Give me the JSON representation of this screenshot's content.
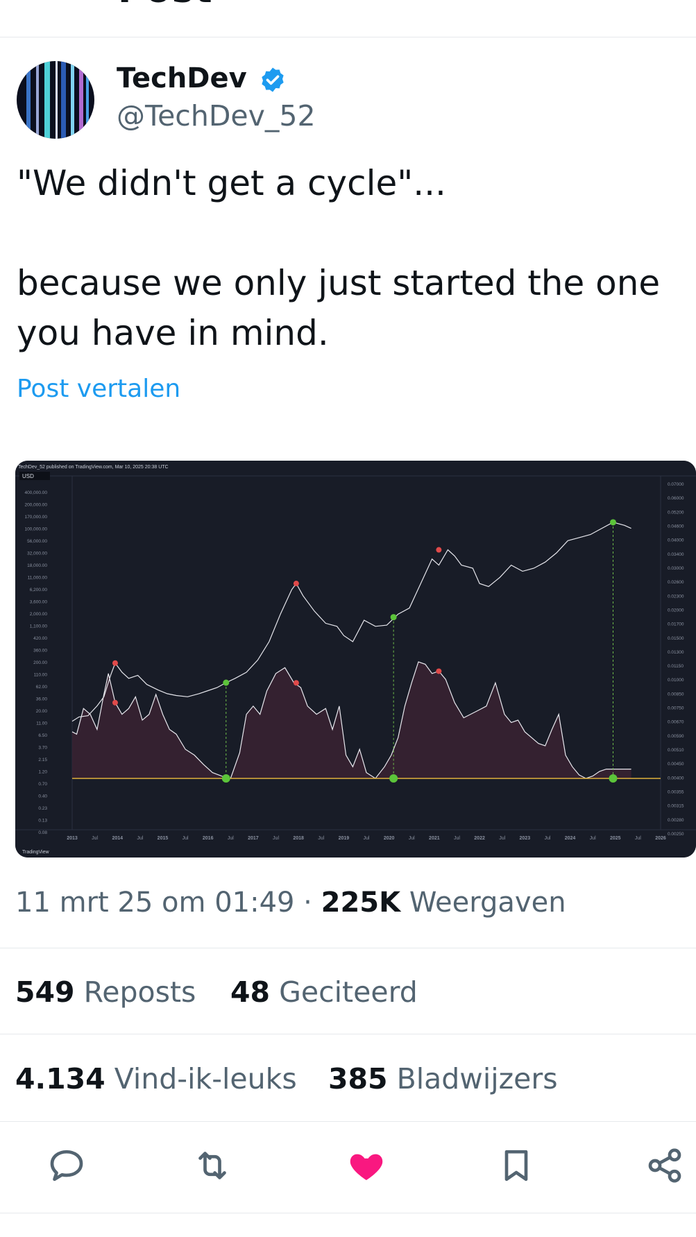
{
  "header": {
    "title_fragment": "Post"
  },
  "author": {
    "name": "TechDev",
    "handle": "@TechDev_52",
    "verified": true
  },
  "tweet": {
    "text": "\"We didn't get a cycle\"...\n\nbecause we only just started the one\nyou have in mind.",
    "translate_label": "Post vertalen"
  },
  "meta": {
    "time": "11 mrt 25 om 01:49",
    "separator": " · ",
    "views_count": "225K",
    "views_label": "Weergaven"
  },
  "stats": {
    "reposts_count": "549",
    "reposts_label": "Reposts",
    "quotes_count": "48",
    "quotes_label": "Geciteerd",
    "likes_count": "4.134",
    "likes_label": "Vind-ik-leuks",
    "bookmarks_count": "385",
    "bookmarks_label": "Bladwijzers"
  },
  "colors": {
    "like_active": "#f91880",
    "link": "#1d9bf0",
    "chart_bg": "#181c27",
    "baseline": "#e0b23c"
  },
  "actions": [
    "reply-icon",
    "repost-icon",
    "like-icon",
    "bookmark-icon",
    "share-icon"
  ],
  "chart_data": {
    "type": "line",
    "header_text": "TechDev_52 published on TradingView.com, Mar 10, 2025 20:38 UTC",
    "currency_label": "USD",
    "watermark": "TradingView",
    "left_axis_ticks": [
      "400,000.00",
      "200,000.00",
      "170,000.00",
      "100,000.00",
      "56,000.00",
      "32,000.00",
      "18,000.00",
      "11,000.00",
      "6,200.00",
      "3,600.00",
      "2,000.00",
      "1,100.00",
      "420.00",
      "360.00",
      "200.00",
      "110.00",
      "62.00",
      "36.00",
      "20.00",
      "11.00",
      "6.50",
      "3.70",
      "2.15",
      "1.20",
      "0.70",
      "0.40",
      "0.23",
      "0.13",
      "0.08"
    ],
    "right_axis_ticks": [
      "0.07000",
      "0.06000",
      "0.05200",
      "0.04600",
      "0.04000",
      "0.03400",
      "0.03000",
      "0.02600",
      "0.02300",
      "0.02000",
      "0.01700",
      "0.01500",
      "0.01300",
      "0.01150",
      "0.01000",
      "0.00850",
      "0.00750",
      "0.00670",
      "0.00590",
      "0.00510",
      "0.00450",
      "0.00400",
      "0.00355",
      "0.00315",
      "0.00280",
      "0.00250"
    ],
    "x_ticks": [
      "2013",
      "Jul",
      "2014",
      "Jul",
      "2015",
      "Jul",
      "2016",
      "Jul",
      "2017",
      "Jul",
      "2018",
      "Jul",
      "2019",
      "Jul",
      "2020",
      "Jul",
      "2021",
      "Jul",
      "2022",
      "Jul",
      "2023",
      "Jul",
      "2024",
      "Jul",
      "2025",
      "Jul",
      "2026"
    ],
    "x_range": [
      2013.0,
      2026.0
    ],
    "price_series": {
      "x": [
        2013.0,
        2013.15,
        2013.35,
        2013.55,
        2013.7,
        2013.85,
        2013.95,
        2014.1,
        2014.25,
        2014.45,
        2014.65,
        2014.9,
        2015.1,
        2015.3,
        2015.55,
        2015.8,
        2016.0,
        2016.2,
        2016.4,
        2016.6,
        2016.85,
        2017.1,
        2017.35,
        2017.6,
        2017.85,
        2017.95,
        2018.1,
        2018.35,
        2018.6,
        2018.85,
        2019.0,
        2019.2,
        2019.45,
        2019.7,
        2019.95,
        2020.2,
        2020.45,
        2020.7,
        2020.95,
        2021.1,
        2021.3,
        2021.45,
        2021.6,
        2021.85,
        2022.0,
        2022.2,
        2022.45,
        2022.7,
        2022.95,
        2023.2,
        2023.45,
        2023.7,
        2023.95,
        2024.2,
        2024.45,
        2024.7,
        2024.95,
        2025.2,
        2025.35
      ],
      "y": [
        0.05,
        0.12,
        0.14,
        0.3,
        0.45,
        0.8,
        1.0,
        0.85,
        0.75,
        0.8,
        0.65,
        0.56,
        0.5,
        0.47,
        0.45,
        0.5,
        0.55,
        0.6,
        0.68,
        0.75,
        0.85,
        1.05,
        1.35,
        1.8,
        2.2,
        2.3,
        2.1,
        1.85,
        1.65,
        1.6,
        1.45,
        1.35,
        1.7,
        1.6,
        1.62,
        1.8,
        1.9,
        2.3,
        2.7,
        2.6,
        2.85,
        2.75,
        2.6,
        2.55,
        2.3,
        2.25,
        2.4,
        2.6,
        2.5,
        2.55,
        2.65,
        2.8,
        3.0,
        3.05,
        3.1,
        3.2,
        3.3,
        3.25,
        3.2
      ]
    },
    "oscillator_series": {
      "x": [
        2013.0,
        2013.1,
        2013.25,
        2013.4,
        2013.55,
        2013.7,
        2013.8,
        2013.95,
        2014.1,
        2014.25,
        2014.4,
        2014.55,
        2014.7,
        2014.85,
        2015.0,
        2015.15,
        2015.3,
        2015.5,
        2015.7,
        2015.9,
        2016.1,
        2016.3,
        2016.5,
        2016.7,
        2016.85,
        2017.0,
        2017.15,
        2017.3,
        2017.5,
        2017.7,
        2017.9,
        2018.05,
        2018.2,
        2018.4,
        2018.6,
        2018.75,
        2018.9,
        2019.05,
        2019.2,
        2019.35,
        2019.5,
        2019.7,
        2019.9,
        2020.05,
        2020.2,
        2020.35,
        2020.5,
        2020.65,
        2020.8,
        2020.95,
        2021.1,
        2021.25,
        2021.45,
        2021.65,
        2021.8,
        2021.95,
        2022.15,
        2022.35,
        2022.55,
        2022.7,
        2022.85,
        2023.0,
        2023.15,
        2023.3,
        2023.45,
        2023.6,
        2023.75,
        2023.9,
        2024.05,
        2024.2,
        2024.35,
        2024.5,
        2024.65,
        2024.8,
        2024.95,
        2025.1,
        2025.25,
        2025.35
      ],
      "y": [
        0.4,
        0.38,
        0.6,
        0.55,
        0.42,
        0.72,
        0.9,
        0.65,
        0.55,
        0.6,
        0.7,
        0.5,
        0.55,
        0.72,
        0.55,
        0.42,
        0.38,
        0.25,
        0.2,
        0.12,
        0.05,
        0.02,
        0.0,
        0.22,
        0.55,
        0.62,
        0.55,
        0.75,
        0.9,
        0.95,
        0.82,
        0.78,
        0.62,
        0.55,
        0.6,
        0.42,
        0.62,
        0.2,
        0.1,
        0.25,
        0.05,
        0.0,
        0.1,
        0.2,
        0.35,
        0.62,
        0.82,
        1.0,
        0.98,
        0.9,
        0.92,
        0.85,
        0.65,
        0.52,
        0.55,
        0.58,
        0.62,
        0.82,
        0.55,
        0.48,
        0.5,
        0.4,
        0.35,
        0.3,
        0.28,
        0.42,
        0.55,
        0.2,
        0.1,
        0.03,
        0.0,
        0.02,
        0.06,
        0.08,
        0.08,
        0.08,
        0.08,
        0.08
      ],
      "baseline": 0.0
    },
    "price_tops": [
      {
        "x": 2013.95,
        "y": 1.0
      },
      {
        "x": 2017.95,
        "y": 2.3
      },
      {
        "x": 2021.1,
        "y": 2.85
      }
    ],
    "price_bottoms": [
      {
        "x": 2016.4,
        "y": 0.68
      },
      {
        "x": 2020.1,
        "y": 1.75
      },
      {
        "x": 2024.95,
        "y": 3.3
      }
    ],
    "oscillator_tops": [
      {
        "x": 2013.95,
        "y": 0.65
      },
      {
        "x": 2017.95,
        "y": 0.82
      },
      {
        "x": 2021.1,
        "y": 0.92
      }
    ],
    "oscillator_bottoms": [
      {
        "x": 2016.4,
        "y": 0.0
      },
      {
        "x": 2020.1,
        "y": 0.0
      },
      {
        "x": 2024.95,
        "y": 0.0
      }
    ]
  }
}
